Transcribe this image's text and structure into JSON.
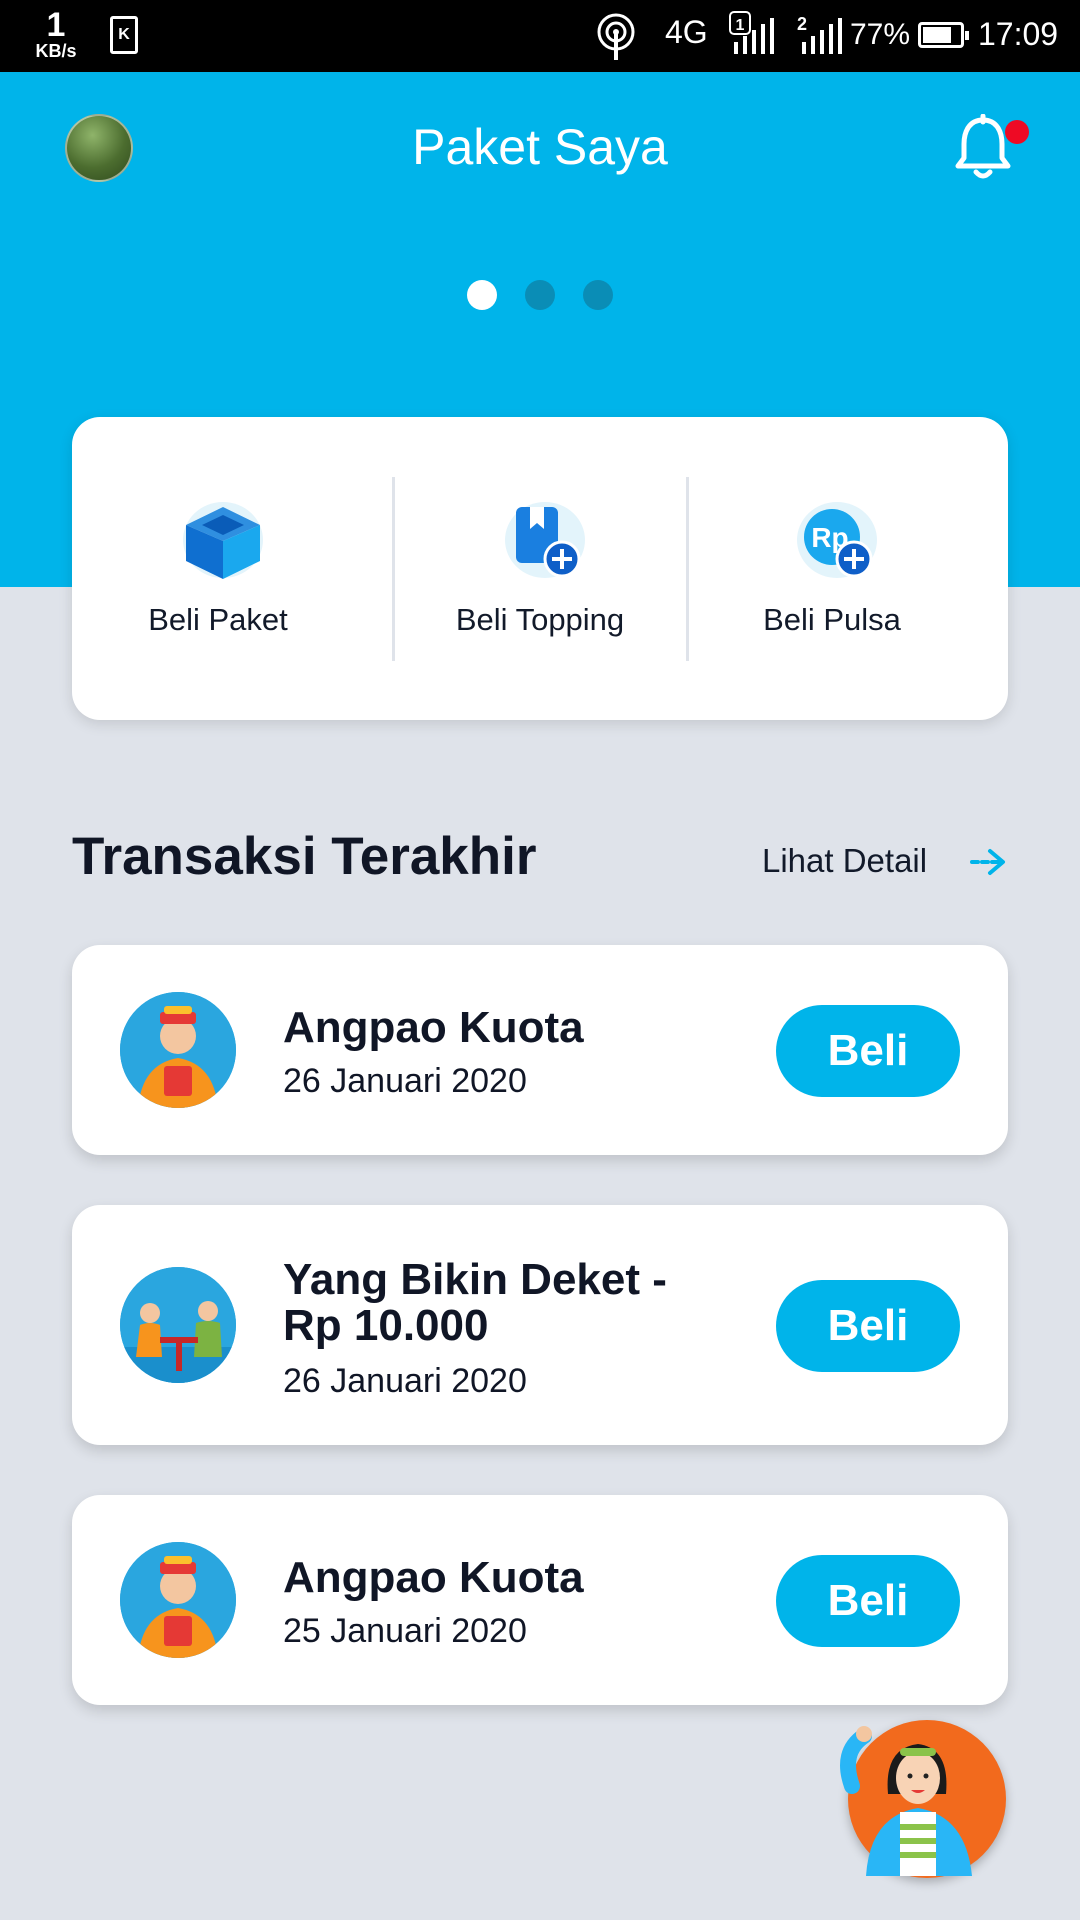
{
  "status_bar": {
    "speed_value": "1",
    "speed_unit": "KB/s",
    "k_icon": "K",
    "network": "4G",
    "sim1": "1",
    "sim2": "2",
    "battery_percent": "77%",
    "battery_level": 0.77,
    "time": "17:09"
  },
  "header": {
    "title": "Paket Saya",
    "carousel_pages": 3,
    "active_page": 1,
    "has_notification": true
  },
  "actions": [
    {
      "label": "Beli Paket",
      "icon": "box-icon"
    },
    {
      "label": "Beli Topping",
      "icon": "book-plus-icon"
    },
    {
      "label": "Beli Pulsa",
      "icon": "rp-plus-icon"
    }
  ],
  "transactions": {
    "title": "Transaksi Terakhir",
    "detail_link": "Lihat Detail",
    "items": [
      {
        "name": "Angpao Kuota",
        "date": "26 Januari 2020",
        "button": "Beli"
      },
      {
        "name_line1": "Yang Bikin Deket -",
        "name_line2": "Rp 10.000",
        "date": "26 Januari 2020",
        "button": "Beli"
      },
      {
        "name": "Angpao Kuota",
        "date": "25 Januari 2020",
        "button": "Beli"
      }
    ]
  },
  "colors": {
    "primary": "#00b4ea",
    "background": "#dfe3ea",
    "accent_orange": "#f26a1d",
    "notification": "#ee0a24"
  }
}
